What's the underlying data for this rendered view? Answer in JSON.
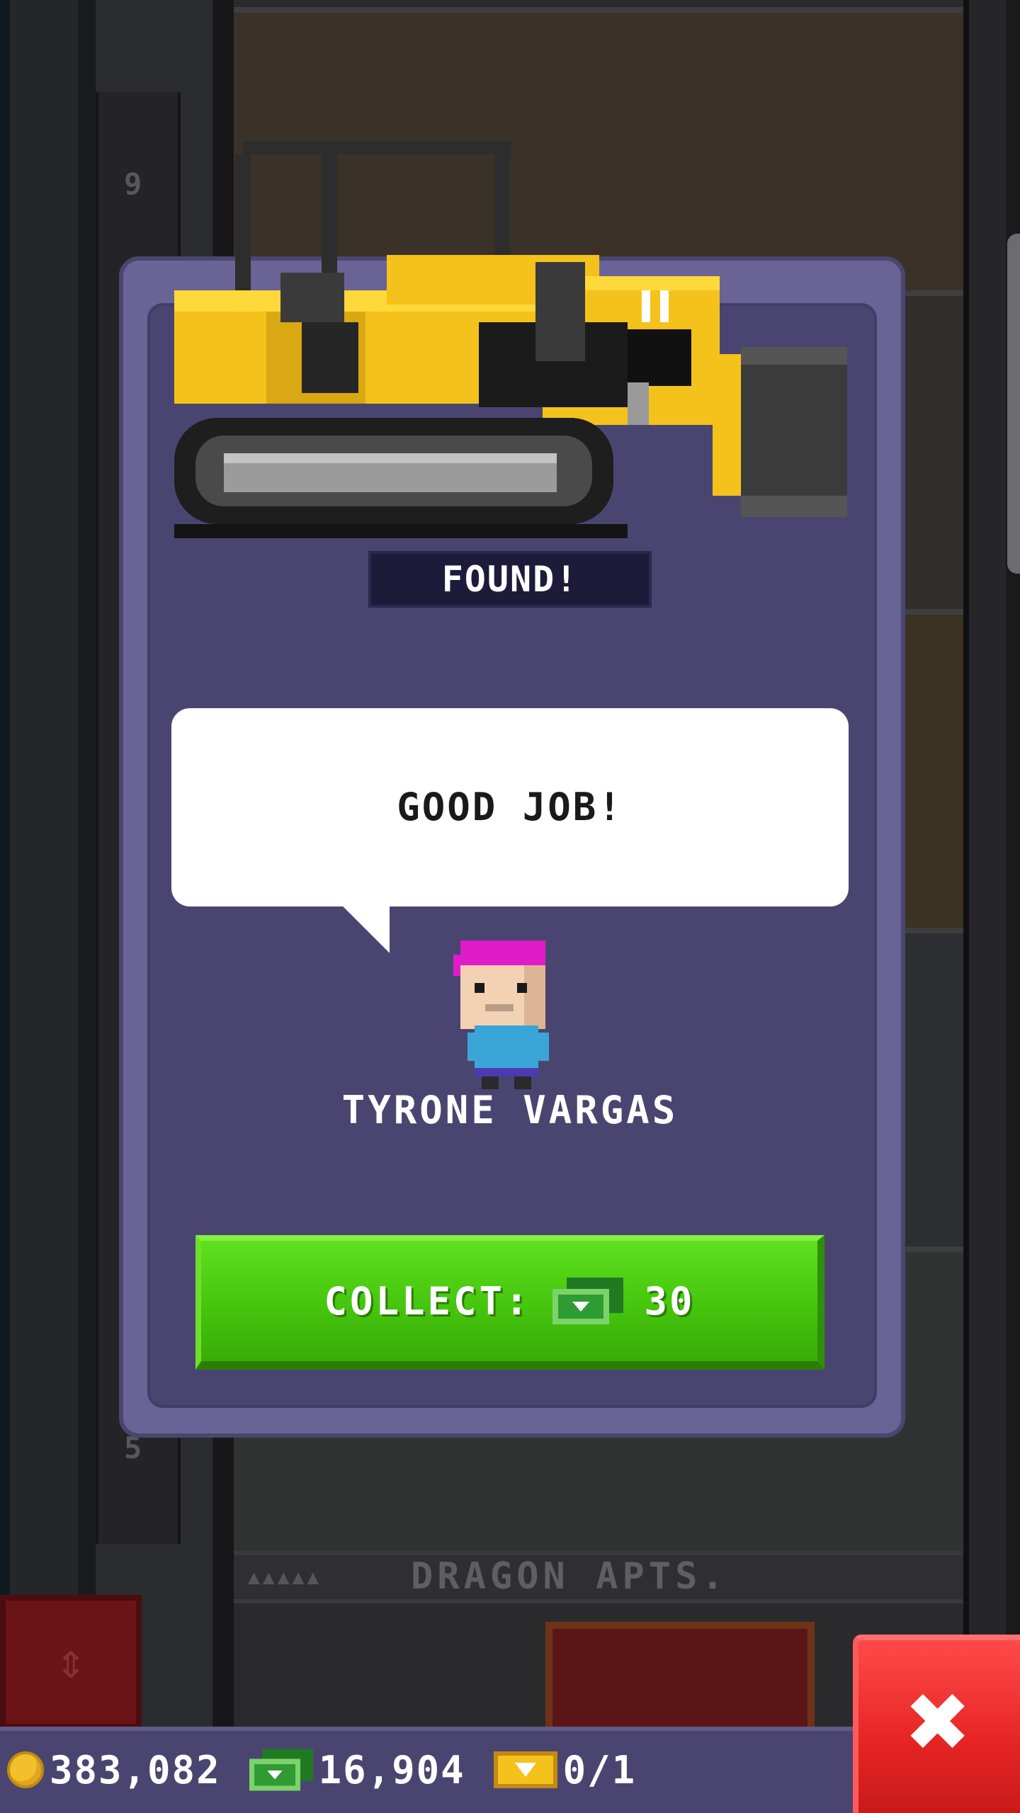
{
  "game": {
    "background": {
      "floor_numbers": [
        "9",
        "5"
      ],
      "banner_label": "DRAGON APTS."
    },
    "modal": {
      "heading": "FOUND!",
      "speech": "GOOD JOB!",
      "character_name": "TYRONE VARGAS",
      "collect": {
        "label": "COLLECT:",
        "amount": "30",
        "currency_icon": "bux-icon"
      }
    },
    "statusbar": {
      "coins": "383,082",
      "bux": "16,904",
      "vip_tickets": "0/1"
    },
    "colors": {
      "panel": "#4a4570",
      "collect_green": "#45c50d",
      "close_red": "#e52424",
      "character_hair": "#e01bc8",
      "character_shirt": "#3aa6d8"
    }
  }
}
